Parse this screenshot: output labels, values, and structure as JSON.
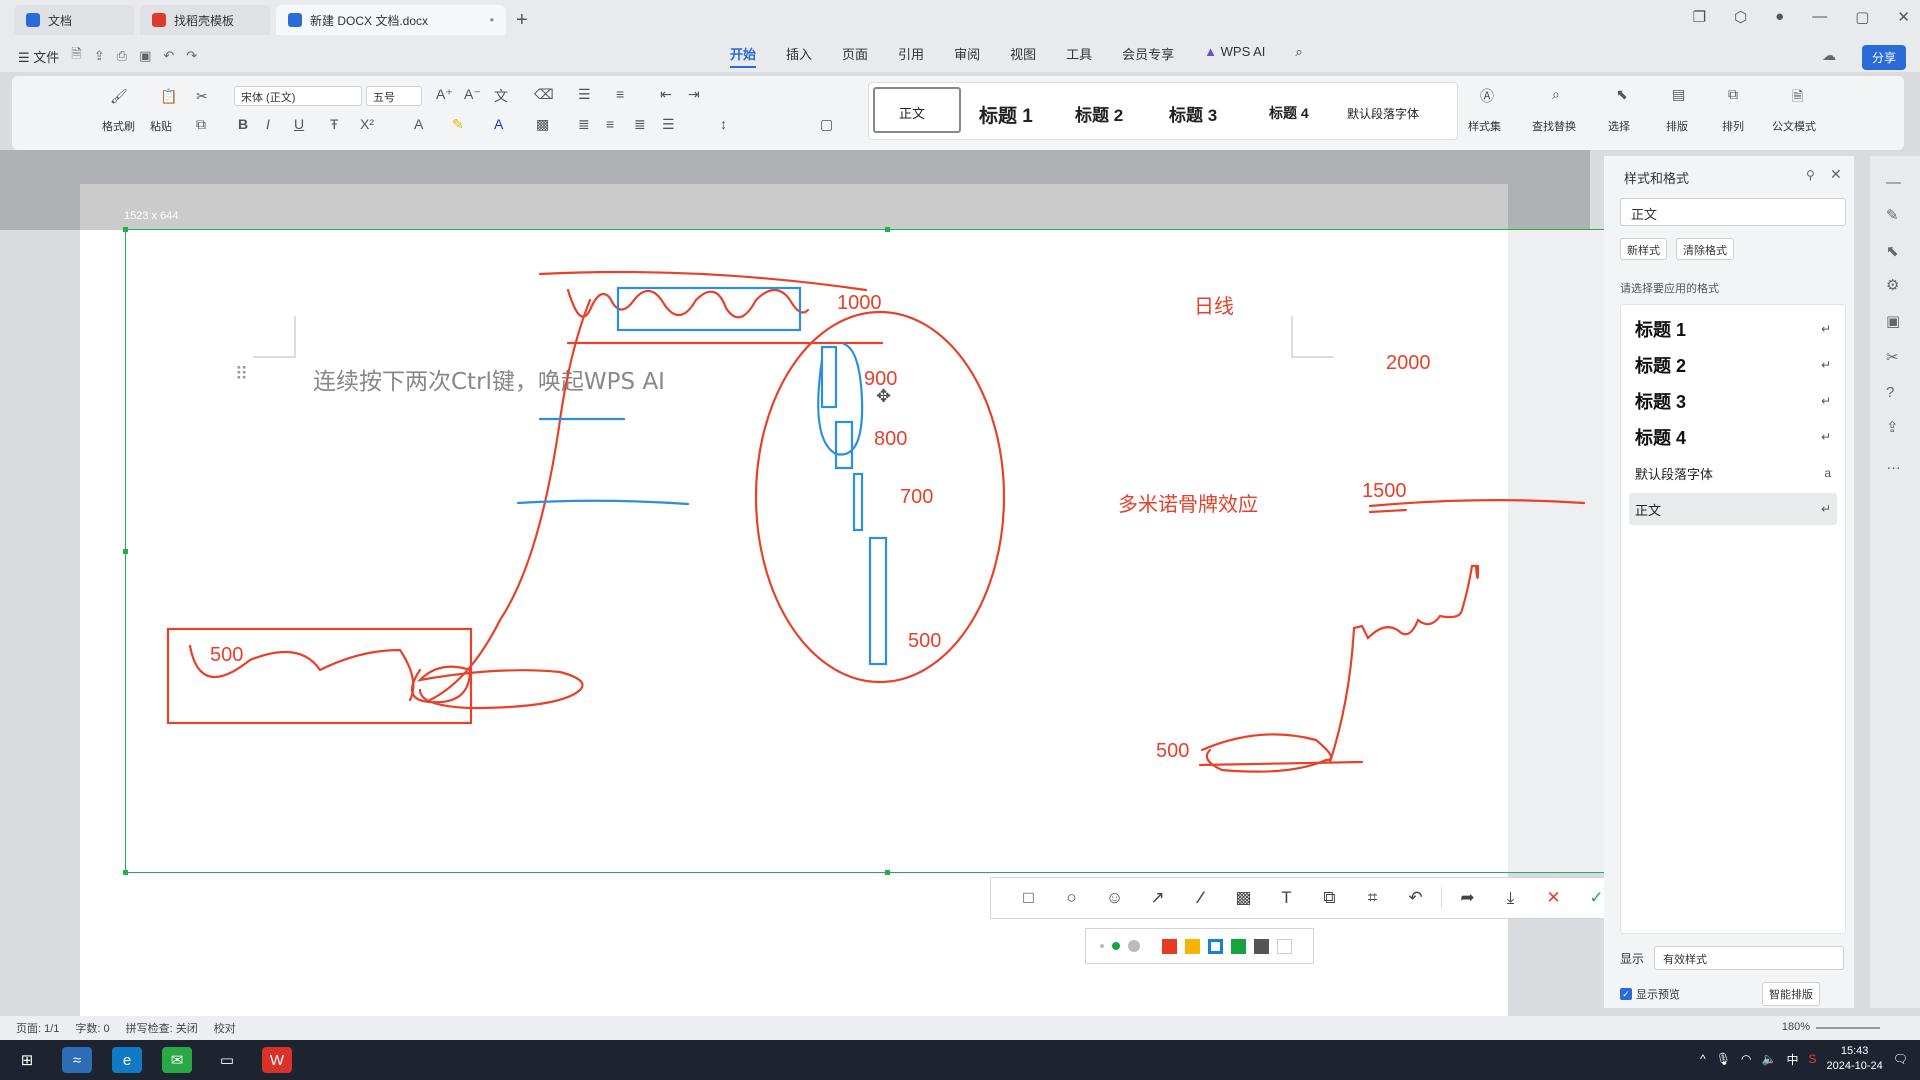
{
  "tabs": [
    {
      "label": "文档",
      "color": "#2a6bd8"
    },
    {
      "label": "找稻壳模板",
      "color": "#e03a2e"
    },
    {
      "label": "新建 DOCX 文档.docx",
      "color": "#2a6bd8"
    }
  ],
  "menu": {
    "file": "文件",
    "items": [
      "开始",
      "插入",
      "页面",
      "引用",
      "审阅",
      "视图",
      "工具",
      "会员专享"
    ],
    "active": "开始",
    "wps_ai": "WPS AI",
    "share": "分享"
  },
  "ribbon": {
    "format_painter": "格式刷",
    "paste": "粘贴",
    "font": "宋体 (正文)",
    "size": "五号",
    "styles": [
      "正文",
      "标题 1",
      "标题 2",
      "标题 3",
      "标题 4",
      "默认段落字体"
    ],
    "style_set": "样式集",
    "find_replace": "查找替换",
    "select": "选择",
    "layout": "排版",
    "arrange": "排列",
    "official": "公文模式"
  },
  "document": {
    "hint": "连续按下两次Ctrl键，唤起WPS AI",
    "selection_size": "1523 x 644"
  },
  "annotations": {
    "n1000": "1000",
    "n900": "900",
    "n800": "800",
    "n700": "700",
    "n500_mid": "500",
    "n500_left": "500",
    "daily": "日线",
    "n2000": "2000",
    "domino": "多米诺骨牌效应",
    "n1500": "1500",
    "n500_right": "500"
  },
  "panel": {
    "title": "样式和格式",
    "current": "正文",
    "new_style": "新样式",
    "clear_format": "清除格式",
    "apply_label": "请选择要应用的格式",
    "items": [
      {
        "label": "标题 1",
        "kind": "h"
      },
      {
        "label": "标题 2",
        "kind": "h"
      },
      {
        "label": "标题 3",
        "kind": "h"
      },
      {
        "label": "标题 4",
        "kind": "h"
      },
      {
        "label": "默认段落字体",
        "kind": "sm"
      },
      {
        "label": "正文",
        "kind": "sm"
      }
    ],
    "show_label": "显示",
    "show_value": "有效样式",
    "preview_label": "显示预览",
    "smart_layout": "智能排版"
  },
  "statusbar": {
    "page": "页面: 1/1",
    "words": "字数: 0",
    "spell": "拼写检查: 关闭",
    "proof": "校对",
    "zoom": "180%"
  },
  "taskbar": {
    "time": "15:43",
    "date": "2024-10-24",
    "ime": "中"
  },
  "colors": {
    "accent": "#2a6bd8",
    "selection": "#21b04b",
    "annotation_red": "#e6412a",
    "annotation_blue": "#2a8fe0",
    "palette": [
      "#e63a22",
      "#f5b400",
      "#1a7fd6",
      "#19a33f",
      "#555555",
      "#ffffff"
    ]
  }
}
